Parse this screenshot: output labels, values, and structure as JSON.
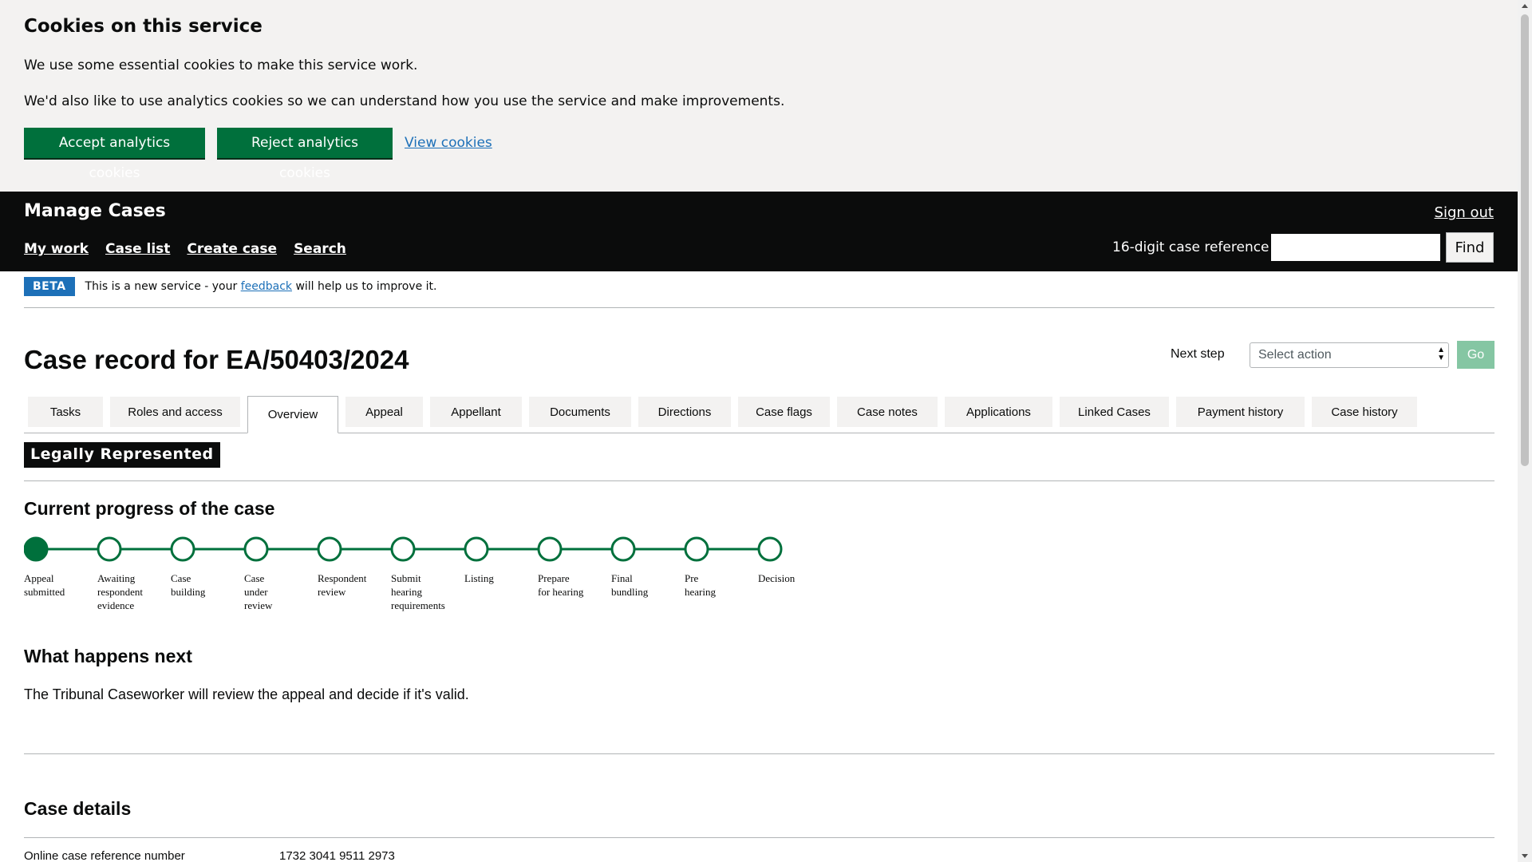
{
  "cookie_banner": {
    "title": "Cookies on this service",
    "paragraph_1": "We use some essential cookies to make this service work.",
    "paragraph_2": "We'd also like to use analytics cookies so we can understand how you use the service and make improvements.",
    "accept_label": "Accept analytics cookies",
    "reject_label": "Reject analytics cookies",
    "view_label": "View cookies"
  },
  "header": {
    "service_name": "Manage Cases",
    "sign_out": "Sign out",
    "nav": [
      "My work",
      "Case list",
      "Create case",
      "Search"
    ],
    "case_ref_label": "16-digit case reference:",
    "case_ref_value": "",
    "find_label": "Find"
  },
  "phase_banner": {
    "tag": "BETA",
    "text_before": "This is a new service - your ",
    "link": "feedback",
    "text_after": " will help us to improve it."
  },
  "page": {
    "title": "Case record for EA/50403/2024",
    "next_step_label": "Next step",
    "select_placeholder": "Select action",
    "go_label": "Go"
  },
  "tabs": [
    {
      "label": "Tasks"
    },
    {
      "label": "Roles and access"
    },
    {
      "label": "Overview",
      "active": true
    },
    {
      "label": "Appeal"
    },
    {
      "label": "Appellant"
    },
    {
      "label": "Documents"
    },
    {
      "label": "Directions"
    },
    {
      "label": "Case flags"
    },
    {
      "label": "Case notes"
    },
    {
      "label": "Applications"
    },
    {
      "label": "Linked Cases"
    },
    {
      "label": "Payment history"
    },
    {
      "label": "Case history"
    }
  ],
  "representation_tag": "Legally Represented",
  "progress": {
    "heading": "Current progress of the case",
    "current_step": 1,
    "steps": [
      [
        "Appeal",
        "submitted"
      ],
      [
        "Awaiting",
        "respondent",
        "evidence"
      ],
      [
        "Case",
        "building"
      ],
      [
        "Case",
        "under",
        "review"
      ],
      [
        "Respondent",
        "review"
      ],
      [
        "Submit",
        "hearing",
        "requirements"
      ],
      [
        "Listing"
      ],
      [
        "Prepare",
        "for hearing"
      ],
      [
        "Final",
        "bundling"
      ],
      [
        "Pre",
        "hearing"
      ],
      [
        "Decision"
      ]
    ],
    "color": "#00703c"
  },
  "what_happens_next": {
    "heading": "What happens next",
    "text": "The Tribunal Caseworker will review the appeal and decide if it's valid."
  },
  "case_details": {
    "heading": "Case details",
    "rows": [
      {
        "key": "Online case reference number",
        "value": "1732 3041 9511 2973"
      }
    ]
  },
  "colors": {
    "govuk_green": "#00703c",
    "header_black": "#0b0c0c",
    "link_blue": "#1d70b8",
    "banner_grey": "#f3f2f1"
  }
}
